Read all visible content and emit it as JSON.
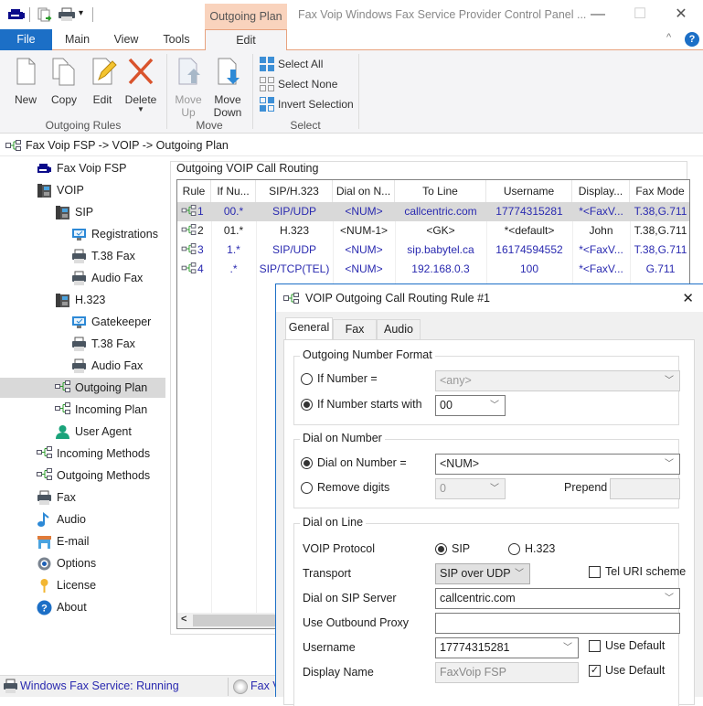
{
  "window": {
    "title": "Fax Voip Windows Fax Service Provider Control Panel ...",
    "context_tab": "Outgoing Plan",
    "controls": {
      "minimize": "—",
      "maximize": "☐",
      "close": "✕"
    }
  },
  "quick_access": [
    "app-icon",
    "export-icon",
    "print-icon",
    "customize-dropdown-icon"
  ],
  "ribbon": {
    "tabs": [
      {
        "label": "File"
      },
      {
        "label": "Main"
      },
      {
        "label": "View"
      },
      {
        "label": "Tools"
      },
      {
        "label": "Edit"
      }
    ],
    "active_tab": "Edit",
    "collapse_icon": "^",
    "help_icon": "?",
    "groups": [
      {
        "label": "Outgoing Rules",
        "buttons": [
          {
            "label": "New"
          },
          {
            "label": "Copy"
          },
          {
            "label": "Edit"
          },
          {
            "label": "Delete"
          }
        ]
      },
      {
        "label": "Move",
        "buttons": [
          {
            "label": "Move Up",
            "line1": "Move",
            "line2": "Up",
            "disabled": true
          },
          {
            "label": "Move Down",
            "line1": "Move",
            "line2": "Down"
          }
        ]
      },
      {
        "label": "Select",
        "buttons": [
          {
            "label": "Select All"
          },
          {
            "label": "Select None"
          },
          {
            "label": "Invert Selection"
          }
        ]
      }
    ]
  },
  "breadcrumb": "Fax Voip FSP -> VOIP -> Outgoing Plan",
  "tree": [
    {
      "label": "Fax Voip FSP",
      "icon": "fax-machine-icon"
    },
    {
      "label": "VOIP",
      "icon": "ip-phone-icon"
    },
    {
      "label": "SIP",
      "icon": "ip-phone-icon"
    },
    {
      "label": "Registrations",
      "icon": "monitor-check-icon"
    },
    {
      "label": "T.38 Fax",
      "icon": "printer-icon"
    },
    {
      "label": "Audio Fax",
      "icon": "printer-icon"
    },
    {
      "label": "H.323",
      "icon": "ip-phone-icon"
    },
    {
      "label": "Gatekeeper",
      "icon": "monitor-check-icon"
    },
    {
      "label": "T.38 Fax",
      "icon": "printer-icon"
    },
    {
      "label": "Audio Fax",
      "icon": "printer-icon"
    },
    {
      "label": "Outgoing Plan",
      "icon": "routing-icon",
      "selected": true
    },
    {
      "label": "Incoming Plan",
      "icon": "routing-icon"
    },
    {
      "label": "User Agent",
      "icon": "user-icon"
    },
    {
      "label": "Incoming Methods",
      "icon": "routing-icon"
    },
    {
      "label": "Outgoing Methods",
      "icon": "routing-icon"
    },
    {
      "label": "Fax",
      "icon": "printer-icon"
    },
    {
      "label": "Audio",
      "icon": "music-note-icon"
    },
    {
      "label": "E-mail",
      "icon": "mailbox-icon"
    },
    {
      "label": "Options",
      "icon": "gear-icon"
    },
    {
      "label": "License",
      "icon": "key-icon"
    },
    {
      "label": "About",
      "icon": "help-icon"
    }
  ],
  "routing": {
    "group_title": "Outgoing VOIP Call Routing",
    "columns": [
      "Rule",
      "If Nu...",
      "SIP/H.323",
      "Dial on N...",
      "To Line",
      "Username",
      "Display...",
      "Fax Mode"
    ],
    "rows": [
      {
        "rule": "1",
        "if_number": "00.*",
        "protocol": "SIP/UDP",
        "dial_on": "<NUM>",
        "to_line": "callcentric.com",
        "username": "17774315281",
        "display": "*<FaxV...",
        "fax_mode": "T.38,G.711",
        "selected": true
      },
      {
        "rule": "2",
        "if_number": "01.*",
        "protocol": "H.323",
        "dial_on": "<NUM-1>",
        "to_line": "<GK>",
        "username": "*<default>",
        "display": "John",
        "fax_mode": "T.38,G.711"
      },
      {
        "rule": "3",
        "if_number": "1.*",
        "protocol": "SIP/UDP",
        "dial_on": "<NUM>",
        "to_line": "sip.babytel.ca",
        "username": "16174594552",
        "display": "*<FaxV...",
        "fax_mode": "T.38,G.711"
      },
      {
        "rule": "4",
        "if_number": ".*",
        "protocol": "SIP/TCP(TEL)",
        "dial_on": "<NUM>",
        "to_line": "192.168.0.3",
        "username": "100",
        "display": "*<FaxV...",
        "fax_mode": "G.711"
      }
    ],
    "scroll_left": "<"
  },
  "status": {
    "fax_service": "Windows Fax Service: Running",
    "second": "Fax V"
  },
  "dialog": {
    "title": "VOIP Outgoing Call Routing Rule #1",
    "close": "✕",
    "tabs": [
      {
        "label": "General"
      },
      {
        "label": "Fax"
      },
      {
        "label": "Audio"
      }
    ],
    "active_tab": "General",
    "outgoing_number_format": {
      "legend": "Outgoing Number Format",
      "if_number_label": "If Number =",
      "if_number_value": "<any>",
      "if_number_selected": false,
      "starts_with_label": "If Number starts with",
      "starts_with_value": "00",
      "starts_with_selected": true
    },
    "dial_on_number": {
      "legend": "Dial on Number",
      "dial_label": "Dial on Number =",
      "dial_value": "<NUM>",
      "dial_selected": true,
      "remove_label": "Remove digits",
      "remove_value": "0",
      "remove_selected": false,
      "prepend_label": "Prepend",
      "prepend_value": ""
    },
    "dial_on_line": {
      "legend": "Dial on Line",
      "protocol_label": "VOIP Protocol",
      "protocol_options": [
        "SIP",
        "H.323"
      ],
      "protocol_selected": "SIP",
      "transport_label": "Transport",
      "transport_value": "SIP over UDP",
      "tel_uri_label": "Tel URI scheme",
      "tel_uri_checked": false,
      "server_label": "Dial on SIP Server",
      "server_value": "callcentric.com",
      "proxy_label": "Use Outbound Proxy",
      "proxy_value": "",
      "username_label": "Username",
      "username_value": "17774315281",
      "username_default_label": "Use Default",
      "username_default_checked": false,
      "display_label": "Display Name",
      "display_value": "FaxVoip FSP",
      "display_default_label": "Use Default",
      "display_default_checked": true
    }
  },
  "colors": {
    "accent": "#1c6fc6",
    "context_tab": "#f9d3bd",
    "link_text": "#2a2ab0",
    "selection": "#d9d9d9"
  }
}
